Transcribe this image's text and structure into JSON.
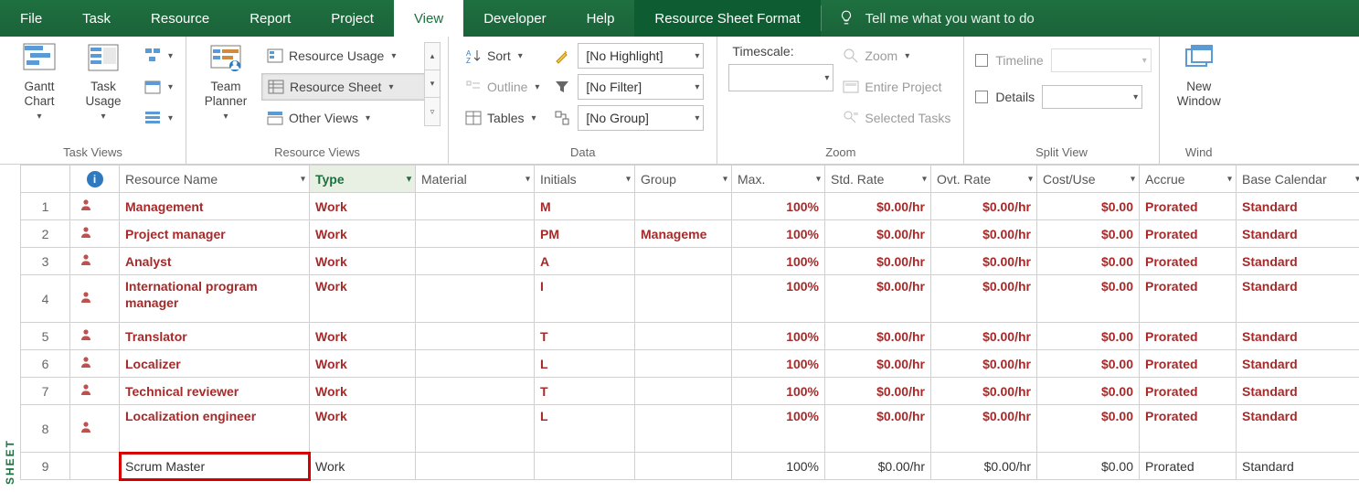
{
  "menu": {
    "file": "File",
    "task": "Task",
    "resource": "Resource",
    "report": "Report",
    "project": "Project",
    "view": "View",
    "developer": "Developer",
    "help": "Help",
    "format": "Resource Sheet Format",
    "tell_me": "Tell me what you want to do"
  },
  "ribbon": {
    "task_views": {
      "label": "Task Views",
      "gantt": "Gantt\nChart",
      "task_usage": "Task\nUsage"
    },
    "resource_views": {
      "label": "Resource Views",
      "team_planner": "Team\nPlanner",
      "resource_usage": "Resource Usage",
      "resource_sheet": "Resource Sheet",
      "other_views": "Other Views"
    },
    "data": {
      "label": "Data",
      "sort": "Sort",
      "outline": "Outline",
      "tables": "Tables",
      "highlight": "[No Highlight]",
      "filter": "[No Filter]",
      "group": "[No Group]"
    },
    "zoom": {
      "label": "Zoom",
      "timescale": "Timescale:",
      "zoom": "Zoom",
      "entire_project": "Entire Project",
      "selected_tasks": "Selected Tasks"
    },
    "split_view": {
      "label": "Split View",
      "timeline": "Timeline",
      "details": "Details"
    },
    "window": {
      "label": "Wind",
      "new_window": "New\nWindow"
    }
  },
  "columns": {
    "resource_name": "Resource Name",
    "type": "Type",
    "material": "Material",
    "initials": "Initials",
    "group": "Group",
    "max": "Max.",
    "std_rate": "Std. Rate",
    "ovt_rate": "Ovt. Rate",
    "cost_use": "Cost/Use",
    "accrue": "Accrue",
    "base_calendar": "Base Calendar"
  },
  "side_label": "SHEET",
  "rows": [
    {
      "n": "1",
      "name": "Management",
      "type": "Work",
      "material": "",
      "initials": "M",
      "group": "",
      "max": "100%",
      "std": "$0.00/hr",
      "ovt": "$0.00/hr",
      "cost": "$0.00",
      "accrue": "Prorated",
      "cal": "Standard",
      "red": true,
      "icon": true
    },
    {
      "n": "2",
      "name": "Project manager",
      "type": "Work",
      "material": "",
      "initials": "PM",
      "group": "Manageme",
      "max": "100%",
      "std": "$0.00/hr",
      "ovt": "$0.00/hr",
      "cost": "$0.00",
      "accrue": "Prorated",
      "cal": "Standard",
      "red": true,
      "icon": true
    },
    {
      "n": "3",
      "name": "Analyst",
      "type": "Work",
      "material": "",
      "initials": "A",
      "group": "",
      "max": "100%",
      "std": "$0.00/hr",
      "ovt": "$0.00/hr",
      "cost": "$0.00",
      "accrue": "Prorated",
      "cal": "Standard",
      "red": true,
      "icon": true
    },
    {
      "n": "4",
      "name": "International program manager",
      "type": "Work",
      "material": "",
      "initials": "I",
      "group": "",
      "max": "100%",
      "std": "$0.00/hr",
      "ovt": "$0.00/hr",
      "cost": "$0.00",
      "accrue": "Prorated",
      "cal": "Standard",
      "red": true,
      "icon": true,
      "tall": true
    },
    {
      "n": "5",
      "name": "Translator",
      "type": "Work",
      "material": "",
      "initials": "T",
      "group": "",
      "max": "100%",
      "std": "$0.00/hr",
      "ovt": "$0.00/hr",
      "cost": "$0.00",
      "accrue": "Prorated",
      "cal": "Standard",
      "red": true,
      "icon": true
    },
    {
      "n": "6",
      "name": "Localizer",
      "type": "Work",
      "material": "",
      "initials": "L",
      "group": "",
      "max": "100%",
      "std": "$0.00/hr",
      "ovt": "$0.00/hr",
      "cost": "$0.00",
      "accrue": "Prorated",
      "cal": "Standard",
      "red": true,
      "icon": true
    },
    {
      "n": "7",
      "name": "Technical reviewer",
      "type": "Work",
      "material": "",
      "initials": "T",
      "group": "",
      "max": "100%",
      "std": "$0.00/hr",
      "ovt": "$0.00/hr",
      "cost": "$0.00",
      "accrue": "Prorated",
      "cal": "Standard",
      "red": true,
      "icon": true
    },
    {
      "n": "8",
      "name": "Localization engineer",
      "type": "Work",
      "material": "",
      "initials": "L",
      "group": "",
      "max": "100%",
      "std": "$0.00/hr",
      "ovt": "$0.00/hr",
      "cost": "$0.00",
      "accrue": "Prorated",
      "cal": "Standard",
      "red": true,
      "icon": true,
      "tall": true
    },
    {
      "n": "9",
      "name": "Scrum Master",
      "type": "Work",
      "material": "",
      "initials": "",
      "group": "",
      "max": "100%",
      "std": "$0.00/hr",
      "ovt": "$0.00/hr",
      "cost": "$0.00",
      "accrue": "Prorated",
      "cal": "Standard",
      "red": false,
      "icon": false,
      "highlight": true
    }
  ]
}
